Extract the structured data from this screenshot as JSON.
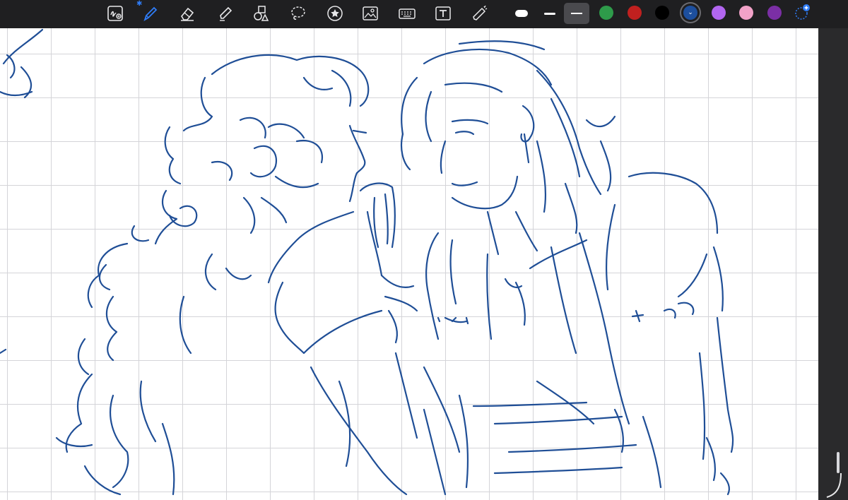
{
  "app": {
    "name": "notes-drawing-canvas"
  },
  "toolbar": {
    "tools": [
      {
        "name": "handwriting-to-text-icon",
        "active": false
      },
      {
        "name": "pen-icon",
        "active": true,
        "bluetooth": true
      },
      {
        "name": "eraser-icon",
        "active": false
      },
      {
        "name": "highlighter-icon",
        "active": false
      },
      {
        "name": "shapes-icon",
        "active": false
      },
      {
        "name": "lasso-icon",
        "active": false
      },
      {
        "name": "sticker-icon",
        "active": false
      },
      {
        "name": "image-icon",
        "active": false
      },
      {
        "name": "keyboard-icon",
        "active": false
      },
      {
        "name": "text-box-icon",
        "active": false
      },
      {
        "name": "laser-pointer-icon",
        "active": false
      }
    ],
    "stroke_widths": [
      {
        "name": "thick-stroke",
        "selected": false
      },
      {
        "name": "medium-stroke",
        "selected": false
      },
      {
        "name": "thin-stroke",
        "selected": true
      }
    ],
    "colors": [
      {
        "name": "green",
        "hex": "#2e9b4a",
        "selected": false
      },
      {
        "name": "red",
        "hex": "#c0201f",
        "selected": false
      },
      {
        "name": "black",
        "hex": "#000000",
        "selected": false
      },
      {
        "name": "navy",
        "hex": "#1d4f9e",
        "selected": true
      },
      {
        "name": "violet",
        "hex": "#b266f0",
        "selected": false
      },
      {
        "name": "pink",
        "hex": "#f2a2c8",
        "selected": false
      },
      {
        "name": "purple",
        "hex": "#7b2fa5",
        "selected": false
      }
    ],
    "add_color": {
      "name": "add-color-icon"
    }
  },
  "canvas": {
    "background": "#ffffff",
    "grid_color": "#d4d4d8",
    "ink_color": "#1f4e96"
  }
}
